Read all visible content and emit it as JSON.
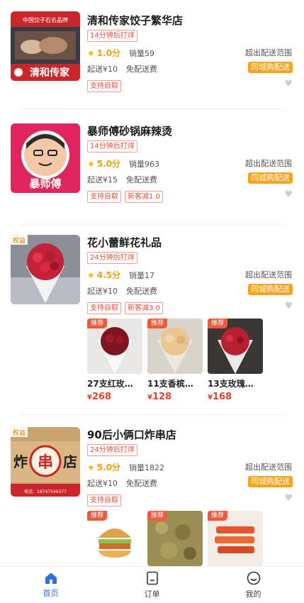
{
  "stores": [
    {
      "name": "清和传家饺子繁华店",
      "hours_tag": "14分钟后打烊",
      "rating": "1.0分",
      "sales": "销量59",
      "min_order": "起送¥10",
      "delivery_fee": "免配送费",
      "range": "超出配送范围",
      "badge": "同城购配送",
      "tags": [
        "支持自取"
      ],
      "thumb_text": "清和传家",
      "thumb_top_text": "中国饺子石名品牌"
    },
    {
      "name": "暴师傅砂锅麻辣烫",
      "hours_tag": "14分钟后打烊",
      "rating": "5.0分",
      "sales": "销量963",
      "min_order": "起送¥15",
      "delivery_fee": "免配送费",
      "range": "超出配送范围",
      "badge": "同城购配送",
      "tags": [
        "支持自取",
        "新客减1.0"
      ],
      "thumb_text": "暴师傅"
    },
    {
      "name": "花小蕾鲜花礼品",
      "hours_tag": "24分钟后打烊",
      "rating": "4.5分",
      "sales": "销量17",
      "min_order": "起送¥10",
      "delivery_fee": "免配送费",
      "range": "超出配送范围",
      "badge": "同城购配送",
      "tags": [
        "支持自取",
        "新客减3.0"
      ],
      "thumb_corner": "权益",
      "products": [
        {
          "badge": "推荐",
          "name": "27支红玫…",
          "price_symbol": "¥",
          "price": "268"
        },
        {
          "badge": "推荐",
          "name": "11支香槟…",
          "price_symbol": "¥",
          "price": "128"
        },
        {
          "badge": "推荐",
          "name": "13支玫瑰…",
          "price_symbol": "¥",
          "price": "168"
        }
      ]
    },
    {
      "name": "90后小俩口炸串店",
      "hours_tag": "24分钟后打烊",
      "rating": "5.0分",
      "sales": "销量1822",
      "min_order": "起送¥10",
      "delivery_fee": "免配送费",
      "range": "超出配送范围",
      "badge": "同城购配送",
      "tags": [
        "支持自取"
      ],
      "thumb_corner": "权益",
      "thumb_sign": [
        "炸",
        "串",
        "店"
      ],
      "thumb_phone": "电话：18747546377",
      "products": [
        {
          "badge": "推荐"
        },
        {
          "badge": "推荐"
        },
        {
          "badge": "推荐"
        }
      ]
    }
  ],
  "tabbar": {
    "items": [
      {
        "label": "首页",
        "icon": "home-icon",
        "active": true
      },
      {
        "label": "订单",
        "icon": "order-icon",
        "active": false
      },
      {
        "label": "我的",
        "icon": "profile-icon",
        "active": false
      }
    ]
  },
  "colors": {
    "accent": "#2f6fe6",
    "price": "#e4432d",
    "badge": "#f6a41f",
    "star": "#f6b51b",
    "tag": "#e8503a"
  }
}
